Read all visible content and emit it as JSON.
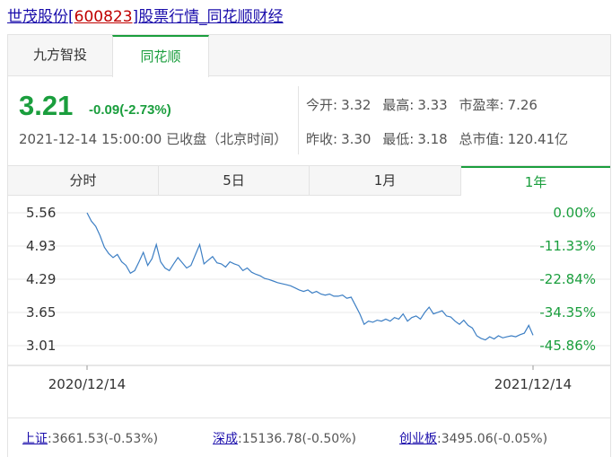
{
  "title": {
    "name": "世茂股份",
    "code_open": "[",
    "code": "600823",
    "code_close": "]",
    "suffix": "股票行情_同花顺财经"
  },
  "source_tabs": [
    {
      "label": "九方智投",
      "active": false
    },
    {
      "label": "同花顺",
      "active": true
    }
  ],
  "quote": {
    "price": "3.21",
    "change": "-0.09(-2.73%)",
    "timestamp": "2021-12-14 15:00:00 已收盘（北京时间）",
    "open_label": "今开:",
    "open": "3.32",
    "high_label": "最高:",
    "high": "3.33",
    "pe_label": "市盈率:",
    "pe": "7.26",
    "prev_close_label": "昨收:",
    "prev_close": "3.30",
    "low_label": "最低:",
    "low": "3.18",
    "mcap_label": "总市值:",
    "mcap": "120.41亿"
  },
  "period_tabs": [
    {
      "label": "分时",
      "active": false
    },
    {
      "label": "5日",
      "active": false
    },
    {
      "label": "1月",
      "active": false
    },
    {
      "label": "1年",
      "active": true
    }
  ],
  "chart_data": {
    "type": "line",
    "y_ticks_left": [
      "5.56",
      "4.93",
      "4.29",
      "3.65",
      "3.01"
    ],
    "y_ticks_right": [
      "0.00%",
      "-11.33%",
      "-22.84%",
      "-34.35%",
      "-45.86%"
    ],
    "ylim": [
      3.01,
      5.56
    ],
    "x_labels": [
      "2020/12/14",
      "2021/12/14"
    ],
    "grid": true,
    "line_color": "#3d7fc4",
    "series": [
      {
        "values": [
          5.56,
          5.4,
          5.3,
          5.12,
          4.9,
          4.78,
          4.7,
          4.76,
          4.62,
          4.55,
          4.4,
          4.45,
          4.62,
          4.8,
          4.55,
          4.68,
          4.95,
          4.62,
          4.5,
          4.45,
          4.58,
          4.7,
          4.6,
          4.5,
          4.55,
          4.75,
          4.95,
          4.58,
          4.65,
          4.72,
          4.6,
          4.58,
          4.52,
          4.62,
          4.58,
          4.55,
          4.45,
          4.5,
          4.42,
          4.38,
          4.35,
          4.3,
          4.28,
          4.25,
          4.22,
          4.2,
          4.18,
          4.16,
          4.12,
          4.08,
          4.05,
          4.08,
          4.02,
          4.05,
          4.0,
          3.98,
          4.0,
          3.96,
          3.96,
          3.98,
          3.92,
          3.94,
          3.78,
          3.62,
          3.42,
          3.48,
          3.46,
          3.5,
          3.48,
          3.52,
          3.48,
          3.55,
          3.52,
          3.62,
          3.48,
          3.55,
          3.58,
          3.52,
          3.65,
          3.75,
          3.62,
          3.65,
          3.68,
          3.58,
          3.56,
          3.48,
          3.42,
          3.5,
          3.4,
          3.35,
          3.2,
          3.15,
          3.12,
          3.18,
          3.14,
          3.2,
          3.16,
          3.18,
          3.2,
          3.18,
          3.22,
          3.25,
          3.4,
          3.21
        ]
      }
    ]
  },
  "indices": [
    {
      "name": "上证",
      "value": ":3661.53(-0.53%)"
    },
    {
      "name": "深成",
      "value": ":15136.78(-0.50%)"
    },
    {
      "name": "创业板",
      "value": ":3495.06(-0.05%)"
    }
  ]
}
